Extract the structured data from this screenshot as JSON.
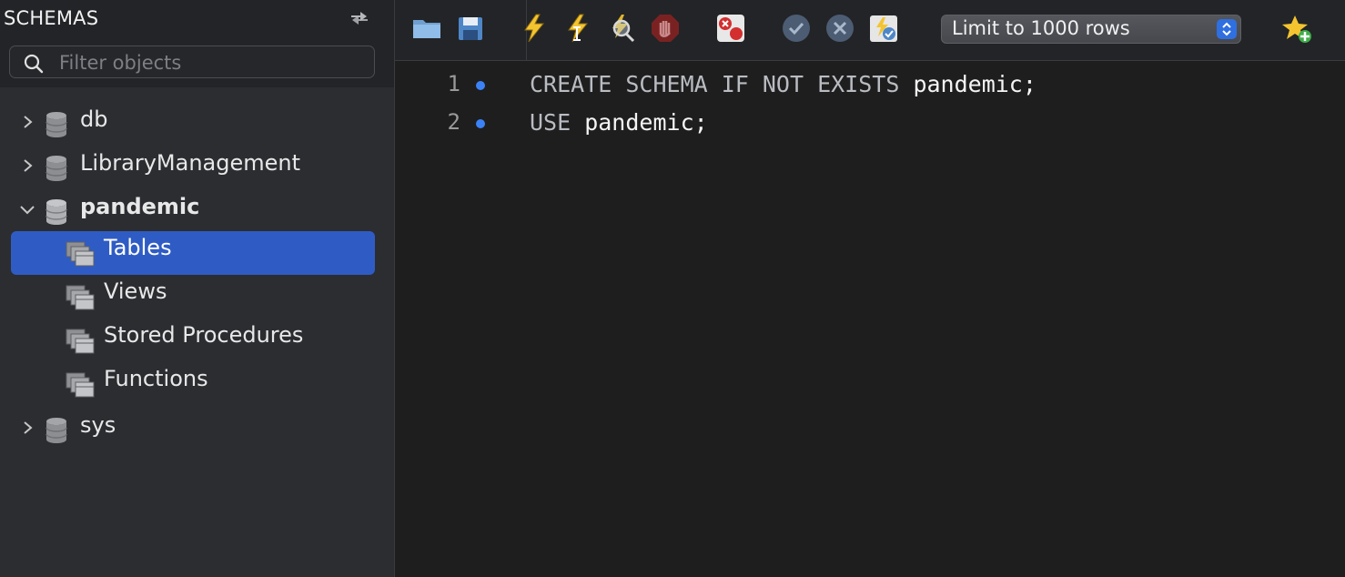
{
  "sidebar": {
    "title": "SCHEMAS",
    "filter": {
      "placeholder": "Filter objects",
      "value": ""
    },
    "schemas": [
      {
        "name": "db",
        "expanded": false
      },
      {
        "name": "LibraryManagement",
        "expanded": false
      },
      {
        "name": "pandemic",
        "expanded": true,
        "children": [
          "Tables",
          "Views",
          "Stored Procedures",
          "Functions"
        ],
        "selected_child": "Tables"
      },
      {
        "name": "sys",
        "expanded": false
      }
    ]
  },
  "toolbar": {
    "icons": [
      "open-folder-icon",
      "save-icon",
      "execute-icon",
      "execute-current-icon",
      "explain-icon",
      "stop-icon",
      "toggle-error-stop-icon",
      "commit-icon",
      "rollback-icon",
      "autocommit-icon",
      "add-snippet-icon"
    ],
    "limit_select": {
      "value": "Limit to 1000 rows"
    }
  },
  "editor": {
    "lines": [
      {
        "number": "1",
        "keywords": "CREATE SCHEMA IF NOT EXISTS",
        "rest": " pandemic;"
      },
      {
        "number": "2",
        "keywords": "USE",
        "rest": " pandemic;"
      }
    ]
  },
  "colors": {
    "selection": "#2f5cc4",
    "sidebar_bg": "#2b2d31",
    "editor_bg": "#1e1e1e",
    "marker": "#3b82f6"
  }
}
